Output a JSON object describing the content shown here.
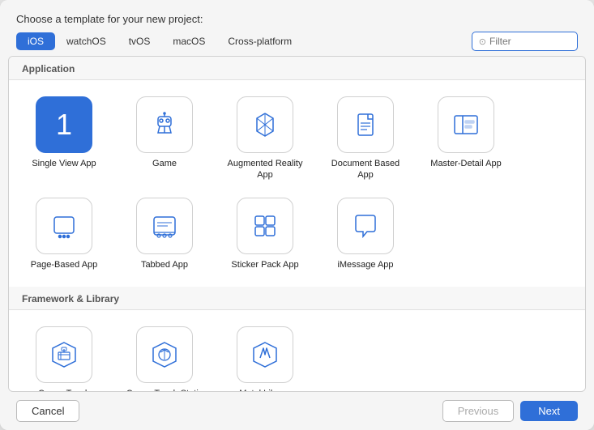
{
  "dialog": {
    "prompt": "Choose a template for your new project:"
  },
  "tabs": {
    "items": [
      "iOS",
      "watchOS",
      "tvOS",
      "macOS",
      "Cross-platform"
    ],
    "active": "iOS"
  },
  "filter": {
    "placeholder": "Filter"
  },
  "sections": [
    {
      "id": "application",
      "label": "Application",
      "templates": [
        {
          "id": "single-view-app",
          "label": "Single View App",
          "selected": true
        },
        {
          "id": "game",
          "label": "Game"
        },
        {
          "id": "augmented-reality-app",
          "label": "Augmented Reality App"
        },
        {
          "id": "document-based-app",
          "label": "Document Based App"
        },
        {
          "id": "master-detail-app",
          "label": "Master-Detail App"
        },
        {
          "id": "page-based-app",
          "label": "Page-Based App"
        },
        {
          "id": "tabbed-app",
          "label": "Tabbed App"
        },
        {
          "id": "sticker-pack-app",
          "label": "Sticker Pack App"
        },
        {
          "id": "imessage-app",
          "label": "iMessage App"
        }
      ]
    },
    {
      "id": "framework-library",
      "label": "Framework & Library",
      "templates": [
        {
          "id": "cocoa-touch-framework",
          "label": "Cocoa Touch Framework"
        },
        {
          "id": "cocoa-touch-static-library",
          "label": "Cocoa Touch Static Library"
        },
        {
          "id": "metal-library",
          "label": "Metal Library"
        }
      ]
    }
  ],
  "footer": {
    "cancel_label": "Cancel",
    "previous_label": "Previous",
    "next_label": "Next"
  }
}
